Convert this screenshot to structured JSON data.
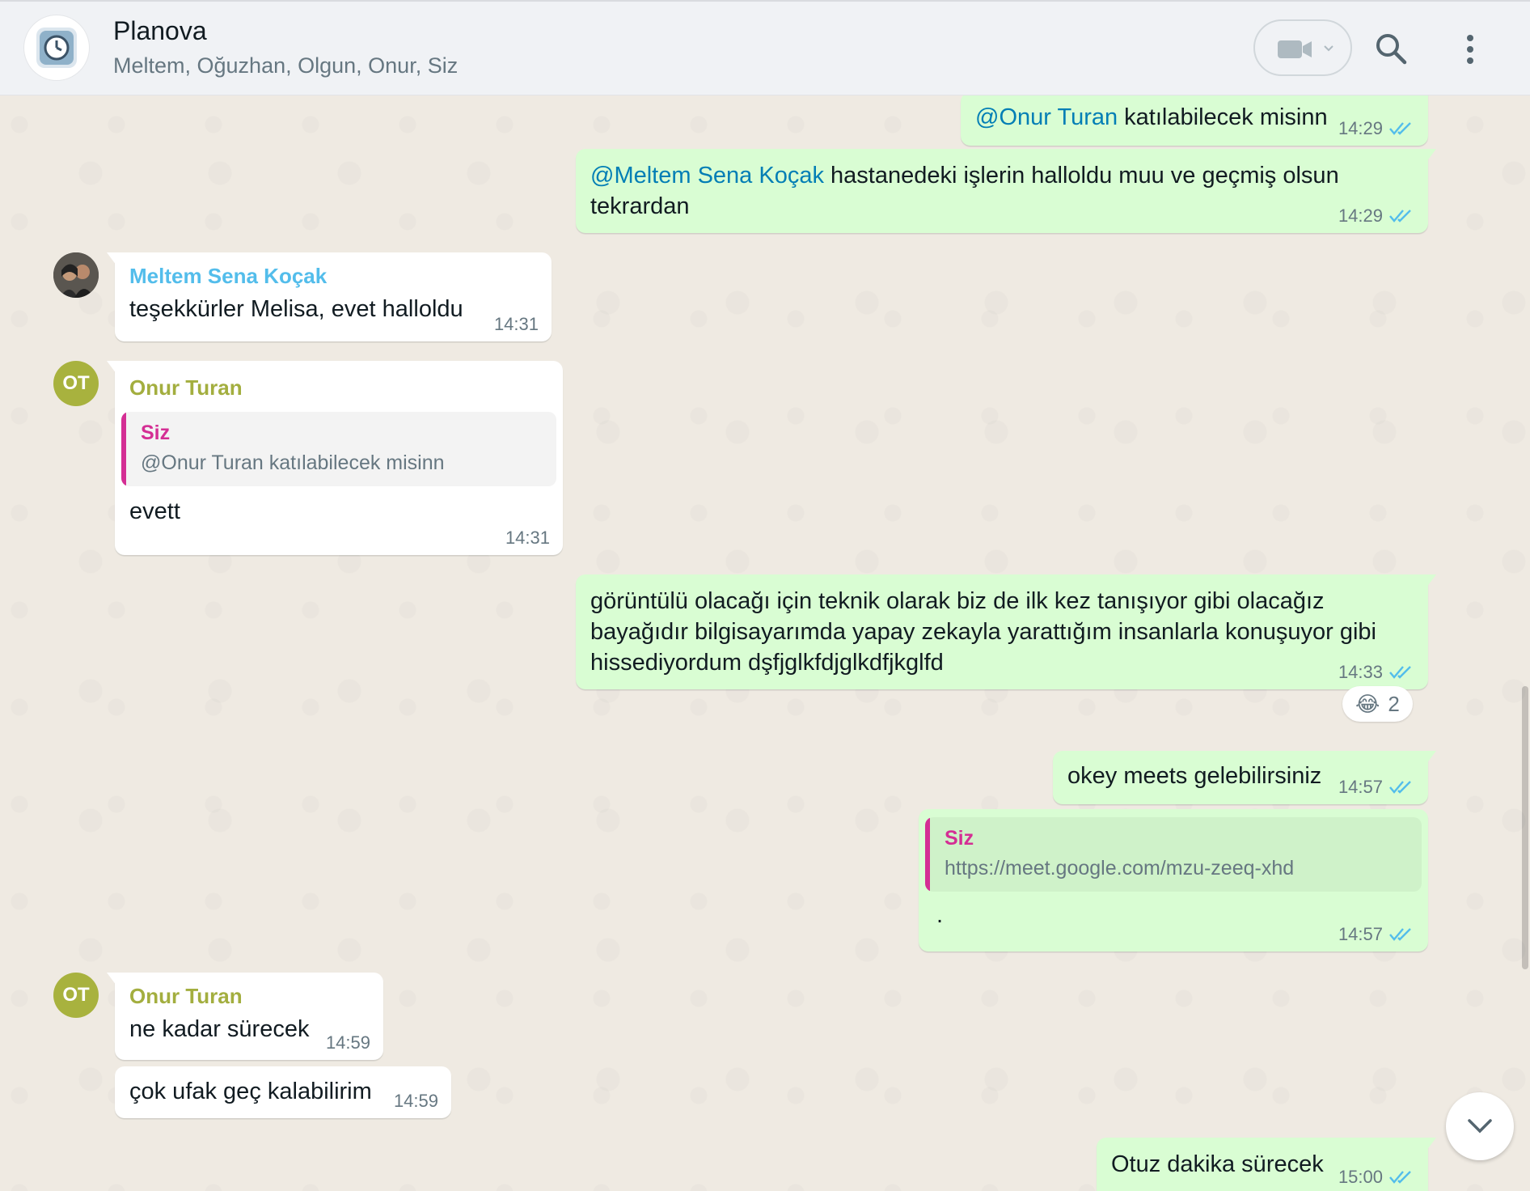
{
  "header": {
    "title": "Planova",
    "members": "Meltem, Oğuzhan, Olgun, Onur, Siz",
    "video_icon": "video-camera-icon",
    "search_icon": "search-icon",
    "menu_icon": "more-vertical-icon"
  },
  "messages": {
    "m1": {
      "mention": "@Onur Turan",
      "text": " katılabilecek misinn",
      "time": "14:29"
    },
    "m2": {
      "mention": "@Meltem Sena Koçak",
      "text": " hastanedeki işlerin halloldu muu ve geçmiş olsun tekrardan",
      "time": "14:29"
    },
    "m3": {
      "sender": "Meltem Sena Koçak",
      "text": "teşekkürler Melisa, evet halloldu",
      "time": "14:31"
    },
    "m4": {
      "avatar": "OT",
      "sender": "Onur Turan",
      "quote_sender": "Siz",
      "quote_text": "@Onur Turan katılabilecek misinn",
      "text": "evett",
      "time": "14:31"
    },
    "m5": {
      "text": "görüntülü olacağı için teknik olarak biz de ilk kez tanışıyor gibi olacağız bayağıdır bilgisayarımda yapay zekayla  yarattığım insanlarla konuşuyor gibi hissediyordum dşfjglkfdjglkdfjkglfd",
      "time": "14:33",
      "reaction_emoji": "😂",
      "reaction_count": "2"
    },
    "m6": {
      "text": "okey meets gelebilirsiniz",
      "time": "14:57"
    },
    "m7": {
      "quote_sender": "Siz",
      "quote_text": "https://meet.google.com/mzu-zeeq-xhd",
      "text": ".",
      "time": "14:57"
    },
    "m8": {
      "avatar": "OT",
      "sender": "Onur Turan",
      "text": "ne kadar sürecek",
      "time": "14:59"
    },
    "m9": {
      "text": "çok ufak geç kalabilirim",
      "time": "14:59"
    },
    "m10": {
      "text": "Otuz dakika sürecek",
      "time": "15:00"
    }
  },
  "colors": {
    "outgoing_bubble": "#d9fdd3",
    "incoming_bubble": "#ffffff",
    "read_ticks": "#53bdeb",
    "mention": "#027eb5",
    "quote_accent": "#d42e94"
  }
}
